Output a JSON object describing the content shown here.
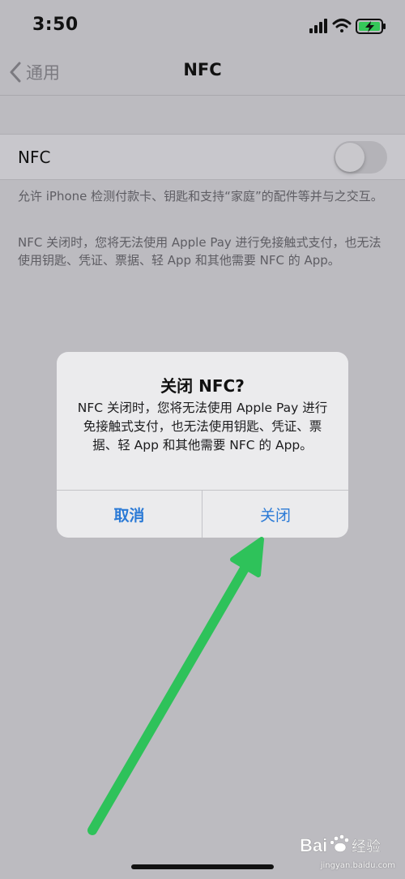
{
  "status_bar": {
    "time": "3:50",
    "icons": [
      "cellular-signal-icon",
      "wifi-icon",
      "battery-charging-icon"
    ]
  },
  "nav": {
    "back_label": "通用",
    "title": "NFC"
  },
  "setting": {
    "label": "NFC",
    "toggle_on": false
  },
  "footnotes": [
    "允许 iPhone 检测付款卡、钥匙和支持“家庭”的配件等并与之交互。",
    "NFC 关闭时，您将无法使用 Apple Pay 进行免接触式支付，也无法使用钥匙、凭证、票据、轻 App 和其他需要 NFC 的 App。"
  ],
  "alert": {
    "title": "关闭 NFC?",
    "message": "NFC 关闭时，您将无法使用 Apple Pay 进行免接触式支付，也无法使用钥匙、凭证、票据、轻 App 和其他需要 NFC 的 App。",
    "cancel_label": "取消",
    "confirm_label": "关闭"
  },
  "colors": {
    "background": "#bcbbc0",
    "alert_button": "#2b7ad6",
    "annotation_arrow": "#2ec25a"
  },
  "watermark": {
    "logo_text": "Bai 经验",
    "url": "jingyan.baidu.com"
  }
}
